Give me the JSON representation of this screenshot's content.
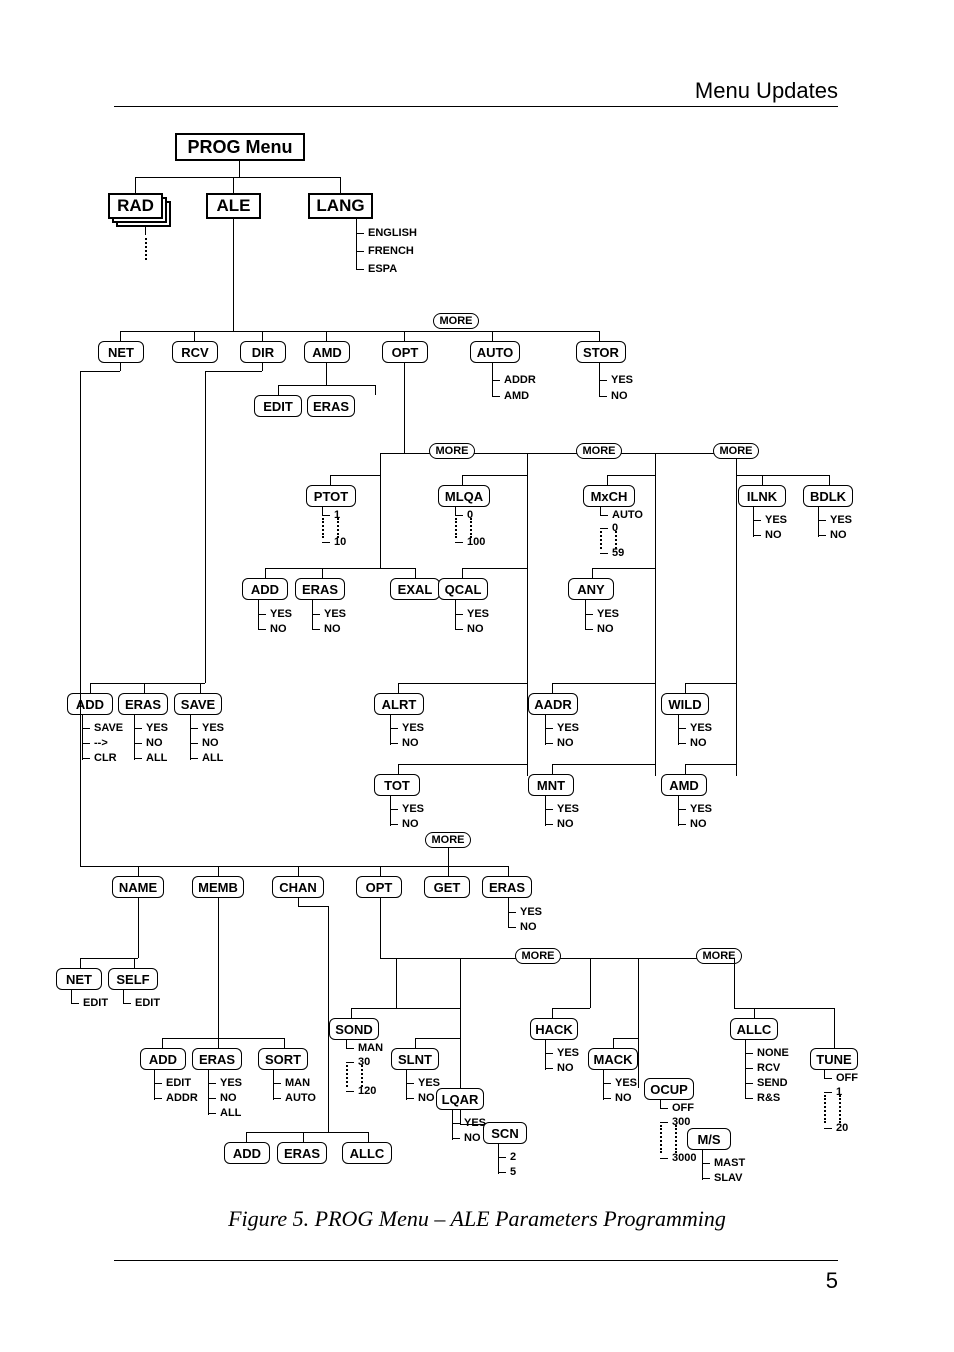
{
  "header": {
    "title": "Menu Updates",
    "page_number": "5"
  },
  "caption": "Figure 5. PROG Menu – ALE Parameters Programming",
  "root": {
    "title": "PROG Menu"
  },
  "level1": {
    "rad": "RAD",
    "ale": "ALE",
    "lang": "LANG"
  },
  "lang_options": [
    "ENGLISH",
    "FRENCH",
    "ESPA"
  ],
  "more_labels": {
    "m1": "MORE",
    "m2a": "MORE",
    "m2b": "MORE",
    "m2c": "MORE",
    "m3": "MORE",
    "m4a": "MORE",
    "m4b": "MORE"
  },
  "ale_row1": {
    "net": "NET",
    "rcv": "RCV",
    "dir": "DIR",
    "amd": "AMD",
    "opt": "OPT",
    "auto": "AUTO",
    "stor": "STOR"
  },
  "auto": {
    "addr": "ADDR",
    "amd": "AMD"
  },
  "stor": {
    "yes": "YES",
    "no": "NO"
  },
  "amd": {
    "edit": "EDIT",
    "eras": "ERAS"
  },
  "group_pt": {
    "ptot": "PTOT",
    "ptot_start": "1",
    "ptot_end": "10",
    "add": "ADD",
    "add_yes": "YES",
    "add_no": "NO",
    "eras": "ERAS",
    "eras_yes": "YES",
    "eras_no": "NO",
    "exal": "EXAL"
  },
  "group_ml": {
    "mlqa": "MLQA",
    "mlqa_start": "0",
    "mlqa_end": "100",
    "qcal": "QCAL",
    "qcal_yes": "YES",
    "qcal_no": "NO",
    "alrt": "ALRT",
    "alrt_yes": "YES",
    "alrt_no": "NO",
    "tot": "TOT",
    "tot_yes": "YES",
    "tot_no": "NO"
  },
  "group_mx": {
    "mxch": "MxCH",
    "mxch_auto": "AUTO",
    "mxch_start": "0",
    "mxch_end": "59",
    "any": "ANY",
    "any_yes": "YES",
    "any_no": "NO",
    "aadr": "AADR",
    "aadr_yes": "YES",
    "aadr_no": "NO",
    "mnt": "MNT",
    "mnt_yes": "YES",
    "mnt_no": "NO"
  },
  "group_il": {
    "ilnk": "ILNK",
    "ilnk_yes": "YES",
    "ilnk_no": "NO",
    "bdlk": "BDLK",
    "bdlk_yes": "YES",
    "bdlk_no": "NO",
    "wild": "WILD",
    "wild_yes": "YES",
    "wild_no": "NO",
    "amd": "AMD",
    "amd_yes": "YES",
    "amd_no": "NO"
  },
  "dir_group": {
    "add": "ADD",
    "add_save": "SAVE",
    "add_arrow": "-->",
    "add_clr": "CLR",
    "eras": "ERAS",
    "eras_yes": "YES",
    "eras_no": "NO",
    "eras_all": "ALL",
    "save": "SAVE",
    "save_yes": "YES",
    "save_no": "NO",
    "save_all": "ALL"
  },
  "net_row": {
    "name": "NAME",
    "memb": "MEMB",
    "chan": "CHAN",
    "opt": "OPT",
    "get": "GET",
    "eras": "ERAS",
    "eras_yes": "YES",
    "eras_no": "NO"
  },
  "name_group": {
    "net": "NET",
    "net_edit": "EDIT",
    "self": "SELF",
    "self_edit": "EDIT"
  },
  "memb_group": {
    "add": "ADD",
    "add_edit": "EDIT",
    "add_addr": "ADDR",
    "eras": "ERAS",
    "eras_yes": "YES",
    "eras_no": "NO",
    "eras_all": "ALL",
    "sort": "SORT",
    "sort_man": "MAN",
    "sort_auto": "AUTO"
  },
  "chan_group": {
    "add": "ADD",
    "eras": "ERAS",
    "allc": "ALLC"
  },
  "opt_cluster": {
    "sond": "SOND",
    "sond_man": "MAN",
    "sond_start": "30",
    "sond_end": "120",
    "slnt": "SLNT",
    "slnt_yes": "YES",
    "slnt_no": "NO",
    "lqar": "LQAR",
    "lqar_yes": "YES",
    "lqar_no": "NO",
    "scn": "SCN",
    "scn_a": "2",
    "scn_b": "5"
  },
  "opt_cluster2": {
    "hack": "HACK",
    "hack_yes": "YES",
    "hack_no": "NO",
    "mack": "MACK",
    "mack_yes": "YES",
    "mack_no": "NO",
    "ocup": "OCUP",
    "ocup_off": "OFF",
    "ocup_start": "300",
    "ocup_end": "3000"
  },
  "opt_cluster3": {
    "allc": "ALLC",
    "allc_none": "NONE",
    "allc_rcv": "RCV",
    "allc_send": "SEND",
    "allc_rs": "R&S",
    "ms": "M/S",
    "ms_mast": "MAST",
    "ms_slav": "SLAV",
    "tune": "TUNE",
    "tune_off": "OFF",
    "tune_start": "1",
    "tune_end": "20"
  }
}
